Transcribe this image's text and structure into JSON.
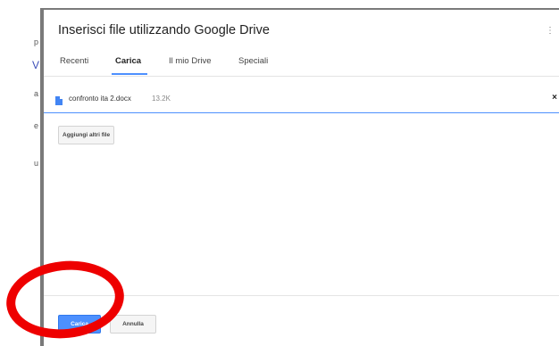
{
  "background": {
    "glyphs": [
      "p",
      "V",
      "a",
      "e",
      "u"
    ]
  },
  "dialog": {
    "title": "Inserisci file utilizzando Google Drive",
    "close_icon": "close-icon",
    "tabs": [
      {
        "label": "Recenti",
        "active": false
      },
      {
        "label": "Carica",
        "active": true
      },
      {
        "label": "Il mio Drive",
        "active": false
      },
      {
        "label": "Speciali",
        "active": false
      }
    ],
    "file": {
      "name": "confronto ita 2.docx",
      "size": "13.2K",
      "icon": "doc-icon",
      "remove_label": "×"
    },
    "add_more_label": "Aggiungi altri file",
    "footer": {
      "upload_label": "Carica",
      "cancel_label": "Annulla"
    }
  },
  "colors": {
    "accent": "#4d90fe",
    "annotation": "#ee0000",
    "doc_icon": "#4285f4"
  }
}
